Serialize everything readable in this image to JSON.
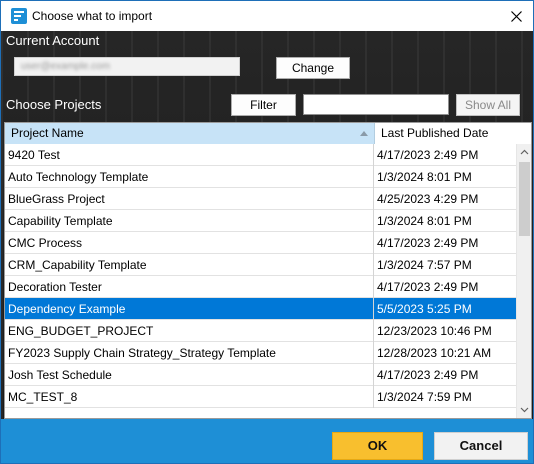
{
  "window": {
    "title": "Choose what to import",
    "icon": "app-import-icon"
  },
  "account": {
    "label": "Current Account",
    "value": "user@example.com",
    "change_label": "Change"
  },
  "projects": {
    "label": "Choose Projects",
    "filter_label": "Filter",
    "filter_value": "",
    "show_all_label": "Show All"
  },
  "grid": {
    "columns": [
      "Project Name",
      "Last Published Date"
    ],
    "sorted_column": "Project Name",
    "rows": [
      {
        "name": "9420 Test",
        "date": "4/17/2023 2:49 PM",
        "selected": false
      },
      {
        "name": "Auto Technology Template",
        "date": "1/3/2024 8:01 PM",
        "selected": false
      },
      {
        "name": "BlueGrass Project",
        "date": "4/25/2023 4:29 PM",
        "selected": false
      },
      {
        "name": "Capability Template",
        "date": "1/3/2024 8:01 PM",
        "selected": false
      },
      {
        "name": "CMC Process",
        "date": "4/17/2023 2:49 PM",
        "selected": false
      },
      {
        "name": "CRM_Capability Template",
        "date": "1/3/2024 7:57 PM",
        "selected": false
      },
      {
        "name": "Decoration Tester",
        "date": "4/17/2023 2:49 PM",
        "selected": false
      },
      {
        "name": "Dependency Example",
        "date": "5/5/2023 5:25 PM",
        "selected": true
      },
      {
        "name": "ENG_BUDGET_PROJECT",
        "date": "12/23/2023 10:46 PM",
        "selected": false
      },
      {
        "name": "FY2023 Supply Chain Strategy_Strategy Template",
        "date": "12/28/2023 10:21 AM",
        "selected": false
      },
      {
        "name": "Josh Test Schedule",
        "date": "4/17/2023 2:49 PM",
        "selected": false
      },
      {
        "name": "MC_TEST_8",
        "date": "1/3/2024 7:59 PM",
        "selected": false
      }
    ]
  },
  "footer": {
    "ok_label": "OK",
    "cancel_label": "Cancel"
  },
  "colors": {
    "accent": "#1e8fd6",
    "selection": "#0078d7",
    "ok_button": "#f8bf2e"
  }
}
